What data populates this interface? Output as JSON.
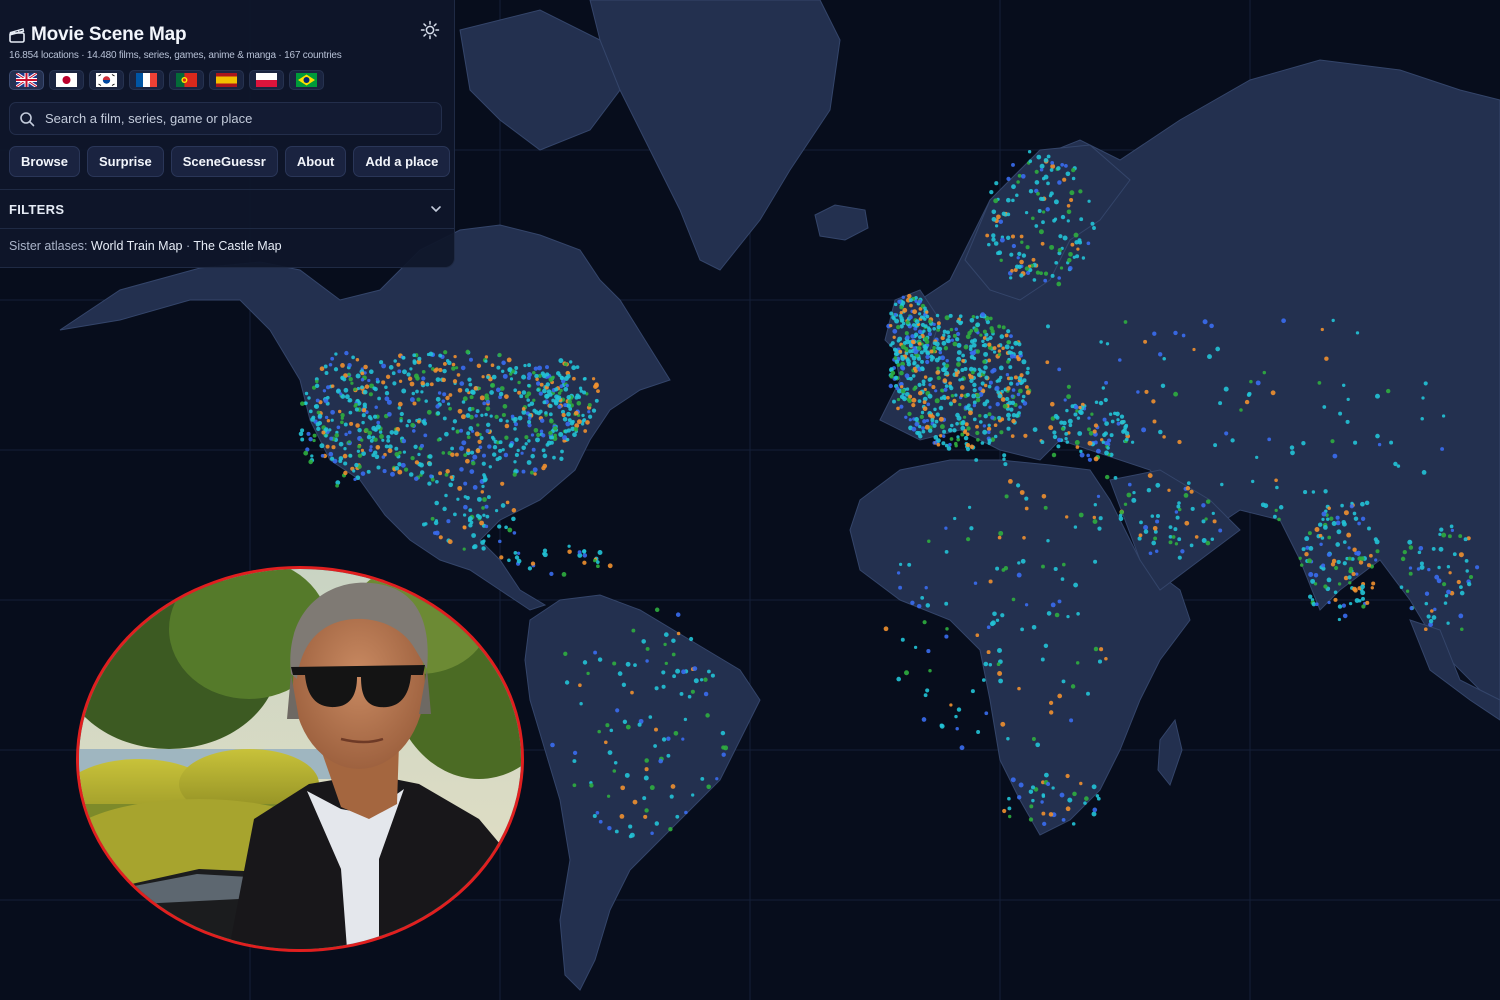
{
  "app": {
    "title": "Movie Scene Map",
    "stats": "16.854 locations · 14.480 films, series, games, anime & manga · 167 countries"
  },
  "icons": {
    "logo": "clapperboard-icon",
    "settings": "sun-icon",
    "search": "search-icon",
    "filters_toggle": "chevron-down-icon"
  },
  "languages": [
    {
      "code": "en",
      "flag": "uk-flag-icon",
      "active": true
    },
    {
      "code": "ja",
      "flag": "japan-flag-icon"
    },
    {
      "code": "ko",
      "flag": "korea-flag-icon"
    },
    {
      "code": "fr",
      "flag": "france-flag-icon"
    },
    {
      "code": "pt",
      "flag": "portugal-flag-icon"
    },
    {
      "code": "es",
      "flag": "spain-flag-icon"
    },
    {
      "code": "pl",
      "flag": "poland-flag-icon"
    },
    {
      "code": "br",
      "flag": "brazil-flag-icon"
    }
  ],
  "search": {
    "placeholder": "Search a film, series, game or place"
  },
  "buttons": {
    "browse": "Browse",
    "surprise": "Surprise",
    "sceneguessr": "SceneGuessr",
    "about": "About",
    "add_place": "Add a place"
  },
  "filters": {
    "label": "FILTERS"
  },
  "sister": {
    "label": "Sister atlases:",
    "link1": "World Train Map",
    "separator": "·",
    "link2": "The Castle Map"
  },
  "colors": {
    "background": "#070d1c",
    "land": "#23304f",
    "panel": "#0f162a",
    "marker_cyan": "#22c3d6",
    "marker_green": "#2fae3f",
    "marker_orange": "#f0902f",
    "marker_blue": "#3a6df0",
    "inset_border": "#e01f1f"
  },
  "inset": {
    "subject": "man in sunglasses and dark suit beside a car, lakeside garden"
  }
}
